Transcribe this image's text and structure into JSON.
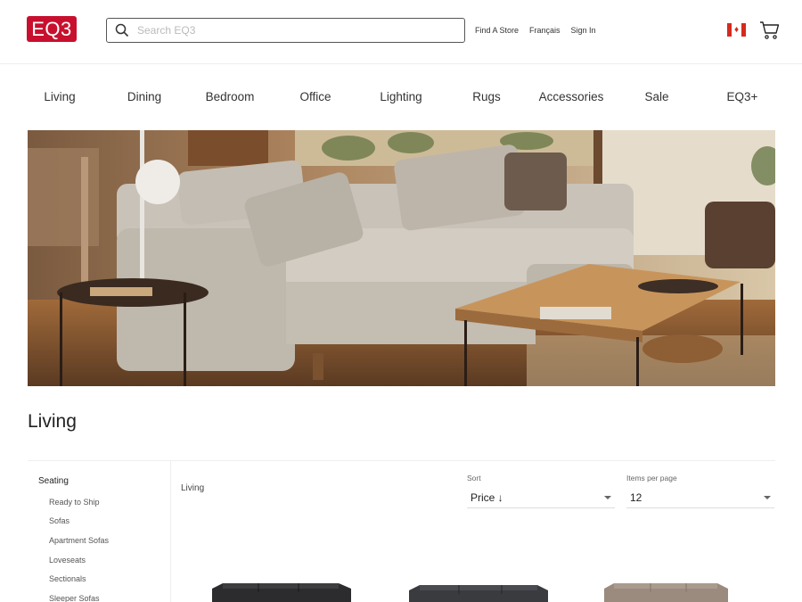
{
  "header": {
    "logo_text": "EQ3",
    "search_placeholder": "Search EQ3",
    "links": [
      "Find A Store",
      "Français",
      "Sign In"
    ],
    "flag_icon": "canada-flag-icon",
    "cart_icon": "cart-icon"
  },
  "nav": {
    "items": [
      "Living",
      "Dining",
      "Bedroom",
      "Office",
      "Lighting",
      "Rugs",
      "Accessories",
      "Sale",
      "EQ3+"
    ]
  },
  "page": {
    "title": "Living",
    "breadcrumb": "Living"
  },
  "sidebar": {
    "heading": "Seating",
    "items": [
      "Ready to Ship",
      "Sofas",
      "Apartment Sofas",
      "Loveseats",
      "Sectionals",
      "Sleeper Sofas"
    ]
  },
  "controls": {
    "sort_label": "Sort",
    "sort_value": "Price ↓",
    "per_page_label": "Items per page",
    "per_page_value": "12"
  },
  "colors": {
    "brand": "#c8102e"
  }
}
